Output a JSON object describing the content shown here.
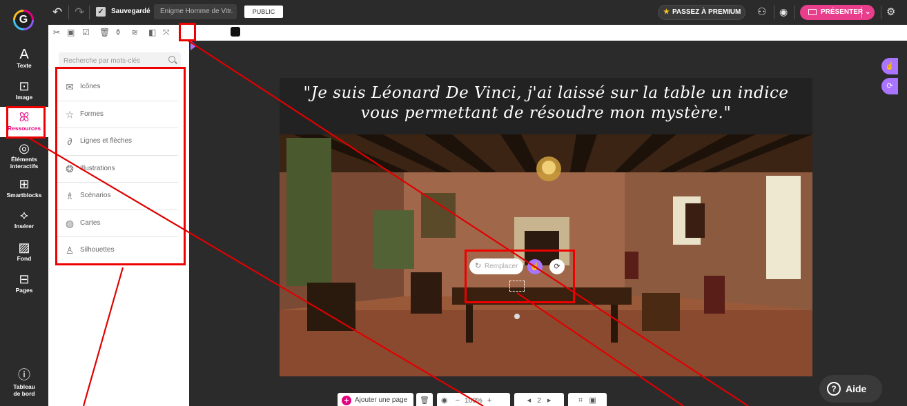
{
  "topbar": {
    "save_status": "Sauvegardé",
    "project_title": "Enigme Homme de Vitr.",
    "visibility_badge": "PUBLIC",
    "premium_label": "PASSEZ À PREMIUM",
    "present_label": "PRÉSENTER"
  },
  "rail": {
    "items": [
      {
        "label": "Texte",
        "icon": "text-icon"
      },
      {
        "label": "Image",
        "icon": "image-icon"
      },
      {
        "label": "Ressources",
        "icon": "resources-icon",
        "active": true
      },
      {
        "label": "Éléments interactifs",
        "icon": "interactive-icon"
      },
      {
        "label": "Smartblocks",
        "icon": "smartblocks-icon"
      },
      {
        "label": "Insérer",
        "icon": "insert-icon"
      },
      {
        "label": "Fond",
        "icon": "background-icon"
      },
      {
        "label": "Pages",
        "icon": "pages-icon"
      },
      {
        "label": "Tableau de bord",
        "icon": "dashboard-icon"
      }
    ]
  },
  "panel": {
    "search_placeholder": "Recherche par mots-clés",
    "items": [
      {
        "label": "Icônes",
        "icon": "envelope-icon"
      },
      {
        "label": "Formes",
        "icon": "star-icon"
      },
      {
        "label": "Lignes et flèches",
        "icon": "link-icon"
      },
      {
        "label": "Illustrations",
        "icon": "palette-icon"
      },
      {
        "label": "Scénarios",
        "icon": "scenario-icon"
      },
      {
        "label": "Cartes",
        "icon": "globe-icon"
      },
      {
        "label": "Silhouettes",
        "icon": "user-icon"
      }
    ]
  },
  "canvas": {
    "quote_line1": "\"Je suis Léonard De Vinci, j'ai laissé sur la table un indice",
    "quote_line2": "vous permettant de résoudre mon mystère.\"",
    "replace_label": "Remplacer"
  },
  "bottom": {
    "add_page_label": "Ajouter une page",
    "zoom_label": "100%",
    "page_number": "2"
  },
  "help": {
    "label": "Aide"
  },
  "colors": {
    "accent": "#e6007e",
    "purple": "#a974ff",
    "annotation": "#e00000"
  }
}
